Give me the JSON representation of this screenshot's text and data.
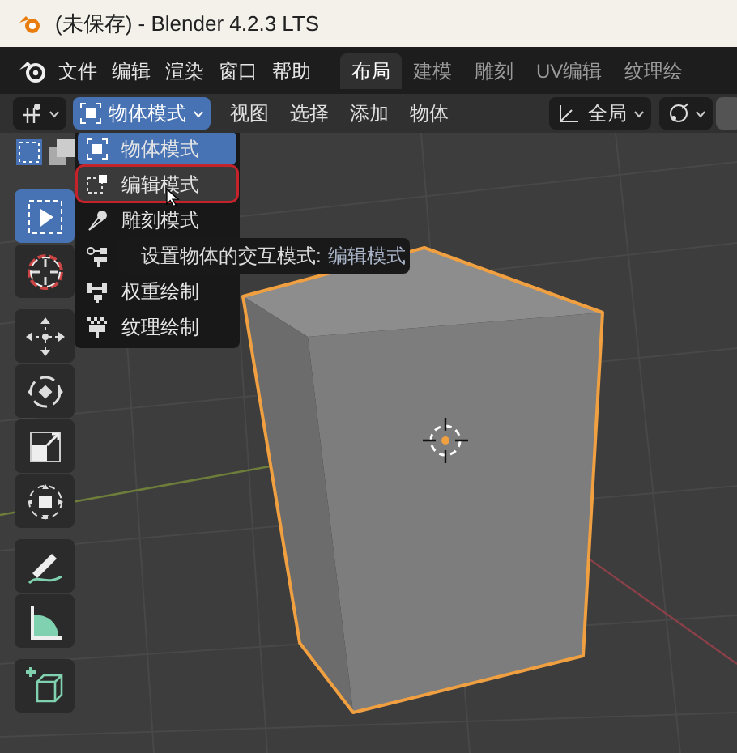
{
  "window": {
    "title": "(未保存) - Blender 4.2.3 LTS"
  },
  "menu_bar": {
    "items": [
      "文件",
      "编辑",
      "渲染",
      "窗口",
      "帮助"
    ]
  },
  "workspace_tabs": [
    {
      "label": "布局",
      "selected": true
    },
    {
      "label": "建模",
      "selected": false
    },
    {
      "label": "雕刻",
      "selected": false
    },
    {
      "label": "UV编辑",
      "selected": false
    },
    {
      "label": "纹理绘",
      "selected": false
    }
  ],
  "header": {
    "mode": "物体模式",
    "menus": [
      "视图",
      "选择",
      "添加",
      "物体"
    ],
    "orientation": "全局"
  },
  "mode_menu": {
    "items": [
      {
        "kind": "object",
        "label": "物体模式",
        "selected": true,
        "highlighted": false
      },
      {
        "kind": "edit",
        "label": "编辑模式",
        "selected": false,
        "highlighted": true
      },
      {
        "kind": "sculpt",
        "label": "雕刻模式",
        "selected": false,
        "highlighted": false
      },
      {
        "kind": "vertex_paint",
        "selected": false,
        "highlighted": false
      },
      {
        "kind": "weight_paint",
        "label": "权重绘制",
        "selected": false,
        "highlighted": false
      },
      {
        "kind": "texture_paint",
        "label": "纹理绘制",
        "selected": false,
        "highlighted": false
      }
    ]
  },
  "tooltip": {
    "text": "设置物体的交互模式:",
    "value": "编辑模式"
  },
  "toolbar": {
    "tools": [
      {
        "kind": "select",
        "selected": true
      },
      {
        "kind": "cursor",
        "selected": false
      },
      {
        "kind": "move",
        "selected": false
      },
      {
        "kind": "rotate",
        "selected": false
      },
      {
        "kind": "scale",
        "selected": false
      },
      {
        "kind": "transform",
        "selected": false
      },
      {
        "kind": "annotate",
        "selected": false
      },
      {
        "kind": "measure",
        "selected": false
      },
      {
        "kind": "add_cube",
        "selected": false
      }
    ]
  }
}
